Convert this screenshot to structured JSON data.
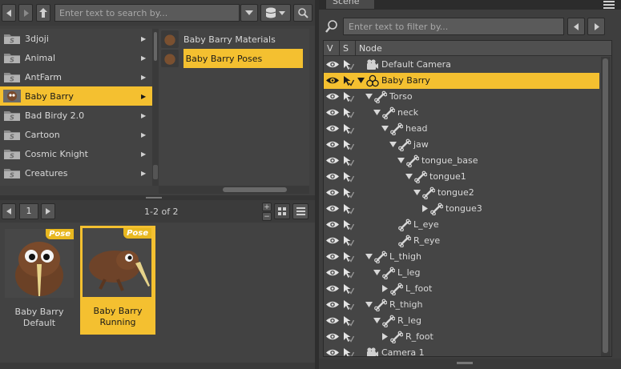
{
  "content_library": {
    "toolbar": {
      "search_placeholder": "Enter text to search by...",
      "icons": [
        "arrow-left-icon",
        "arrow-right-icon",
        "up-arrow-icon",
        "dropdown-icon",
        "database-icon",
        "search-icon"
      ]
    },
    "categories": [
      {
        "label": "3djoji",
        "selected": false
      },
      {
        "label": "Animal",
        "selected": false
      },
      {
        "label": "AntFarm",
        "selected": false
      },
      {
        "label": "Baby Barry",
        "selected": true
      },
      {
        "label": "Bad Birdy 2.0",
        "selected": false
      },
      {
        "label": "Cartoon",
        "selected": false
      },
      {
        "label": "Cosmic Knight",
        "selected": false
      },
      {
        "label": "Creatures",
        "selected": false
      }
    ],
    "subcategories": [
      {
        "label": "Baby Barry Materials",
        "selected": false
      },
      {
        "label": "Baby Barry Poses",
        "selected": true
      }
    ],
    "pager": {
      "page": "1",
      "result_count": "1-2 of 2"
    },
    "items": [
      {
        "line1": "Baby Barry",
        "line2": "Default",
        "badge": "Pose",
        "selected": false
      },
      {
        "line1": "Baby Barry",
        "line2": "Running",
        "badge": "Pose",
        "selected": true
      }
    ]
  },
  "scene": {
    "tab_label": "Scene",
    "filter_placeholder": "Enter text to filter by...",
    "columns": {
      "visible": "V",
      "selectable": "S",
      "node": "Node"
    },
    "nodes": [
      {
        "label": "Default Camera",
        "depth": 0,
        "icon": "camera-icon",
        "expander": "none",
        "selected": false
      },
      {
        "label": "Baby Barry",
        "depth": 0,
        "icon": "figure-icon",
        "expander": "open",
        "selected": true
      },
      {
        "label": "Torso",
        "depth": 1,
        "icon": "bone-icon",
        "expander": "open",
        "selected": false
      },
      {
        "label": "neck",
        "depth": 2,
        "icon": "bone-icon",
        "expander": "open",
        "selected": false
      },
      {
        "label": "head",
        "depth": 3,
        "icon": "bone-icon",
        "expander": "open",
        "selected": false
      },
      {
        "label": "jaw",
        "depth": 4,
        "icon": "bone-icon",
        "expander": "open",
        "selected": false
      },
      {
        "label": "tongue_base",
        "depth": 5,
        "icon": "bone-icon",
        "expander": "open",
        "selected": false
      },
      {
        "label": "tongue1",
        "depth": 6,
        "icon": "bone-icon",
        "expander": "open",
        "selected": false
      },
      {
        "label": "tongue2",
        "depth": 7,
        "icon": "bone-icon",
        "expander": "open",
        "selected": false
      },
      {
        "label": "tongue3",
        "depth": 8,
        "icon": "bone-icon",
        "expander": "closed",
        "selected": false
      },
      {
        "label": "L_eye",
        "depth": 4,
        "icon": "bone-icon",
        "expander": "none",
        "selected": false
      },
      {
        "label": "R_eye",
        "depth": 4,
        "icon": "bone-icon",
        "expander": "none",
        "selected": false
      },
      {
        "label": "L_thigh",
        "depth": 1,
        "icon": "bone-icon",
        "expander": "open",
        "selected": false
      },
      {
        "label": "L_leg",
        "depth": 2,
        "icon": "bone-icon",
        "expander": "open",
        "selected": false
      },
      {
        "label": "L_foot",
        "depth": 3,
        "icon": "bone-icon",
        "expander": "closed",
        "selected": false
      },
      {
        "label": "R_thigh",
        "depth": 1,
        "icon": "bone-icon",
        "expander": "open",
        "selected": false
      },
      {
        "label": "R_leg",
        "depth": 2,
        "icon": "bone-icon",
        "expander": "open",
        "selected": false
      },
      {
        "label": "R_foot",
        "depth": 3,
        "icon": "bone-icon",
        "expander": "closed",
        "selected": false
      },
      {
        "label": "Camera 1",
        "depth": 0,
        "icon": "camera-icon",
        "expander": "none",
        "selected": false
      }
    ]
  },
  "colors": {
    "selection": "#f4c030",
    "panel": "#3f3f3f",
    "text": "#d8d8d8"
  }
}
